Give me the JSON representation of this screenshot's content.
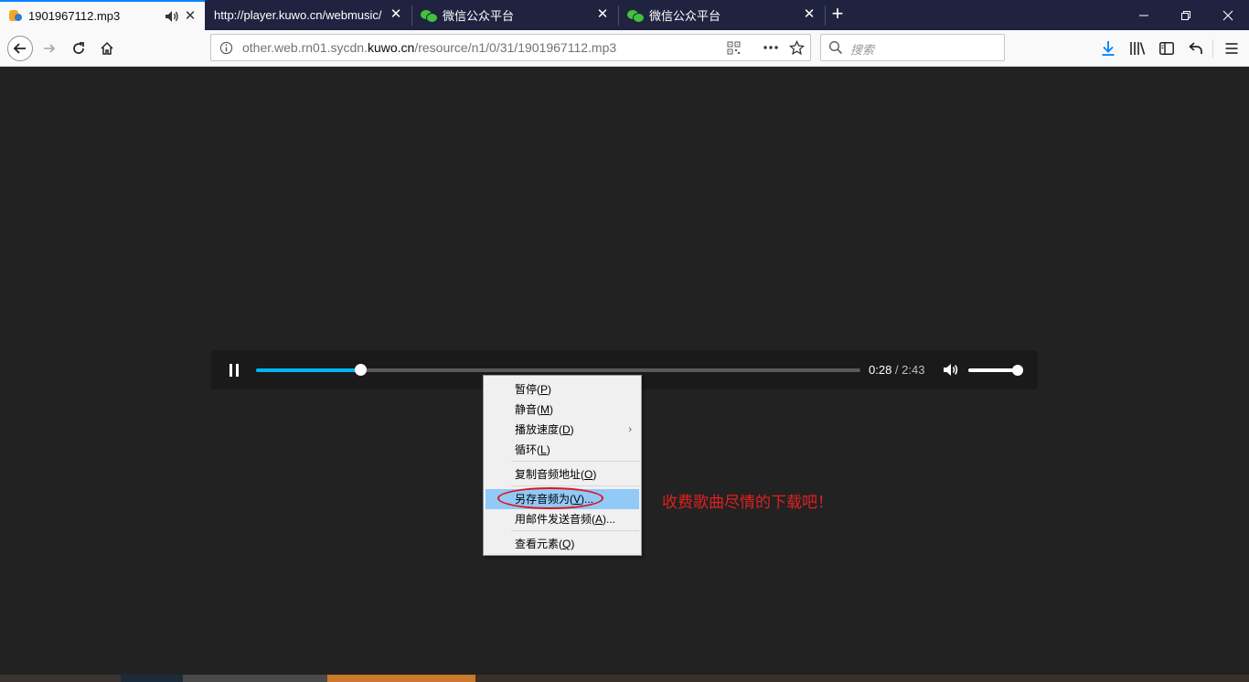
{
  "tabs": [
    {
      "title": "1901967112.mp3",
      "active": true,
      "favicon": "kuwo-favicon-icon",
      "playing": true
    },
    {
      "title": "http://player.kuwo.cn/webmusic/",
      "active": false,
      "favicon": null
    },
    {
      "title": "微信公众平台",
      "active": false,
      "favicon": "wechat-favicon-icon"
    },
    {
      "title": "微信公众平台",
      "active": false,
      "favicon": "wechat-favicon-icon"
    }
  ],
  "navbar": {
    "url_prefix": "other.web.rn01.sycdn.",
    "url_domain": "kuwo.cn",
    "url_suffix": "/resource/n1/0/31/1901967112.mp3",
    "search_placeholder": "搜索"
  },
  "player": {
    "current_time": "0:28",
    "separator": " / ",
    "duration": "2:43",
    "progress_fraction": 0.172,
    "volume_fraction": 1.0,
    "state": "playing"
  },
  "context_menu": {
    "items": [
      {
        "label": "暂停(",
        "key": "P",
        "tail": ")"
      },
      {
        "label": "静音(",
        "key": "M",
        "tail": ")"
      },
      {
        "label": "播放速度(",
        "key": "D",
        "tail": ")",
        "submenu": true
      },
      {
        "label": "循环(",
        "key": "L",
        "tail": ")"
      },
      {
        "label": "复制音频地址(",
        "key": "O",
        "tail": ")"
      },
      {
        "label": "另存音频为(",
        "key": "V",
        "tail": ")...",
        "highlighted": true
      },
      {
        "label": "用邮件发送音频(",
        "key": "A",
        "tail": ")..."
      },
      {
        "label": "查看元素(",
        "key": "Q",
        "tail": ")"
      }
    ]
  },
  "annotation": {
    "text": "收费歌曲尽情的下载吧！",
    "color": "#e02020"
  },
  "colors": {
    "tabbar": "#202340",
    "accent": "#0a84ff",
    "progress": "#00b6f0",
    "menu_highlight": "#91c9f7"
  }
}
